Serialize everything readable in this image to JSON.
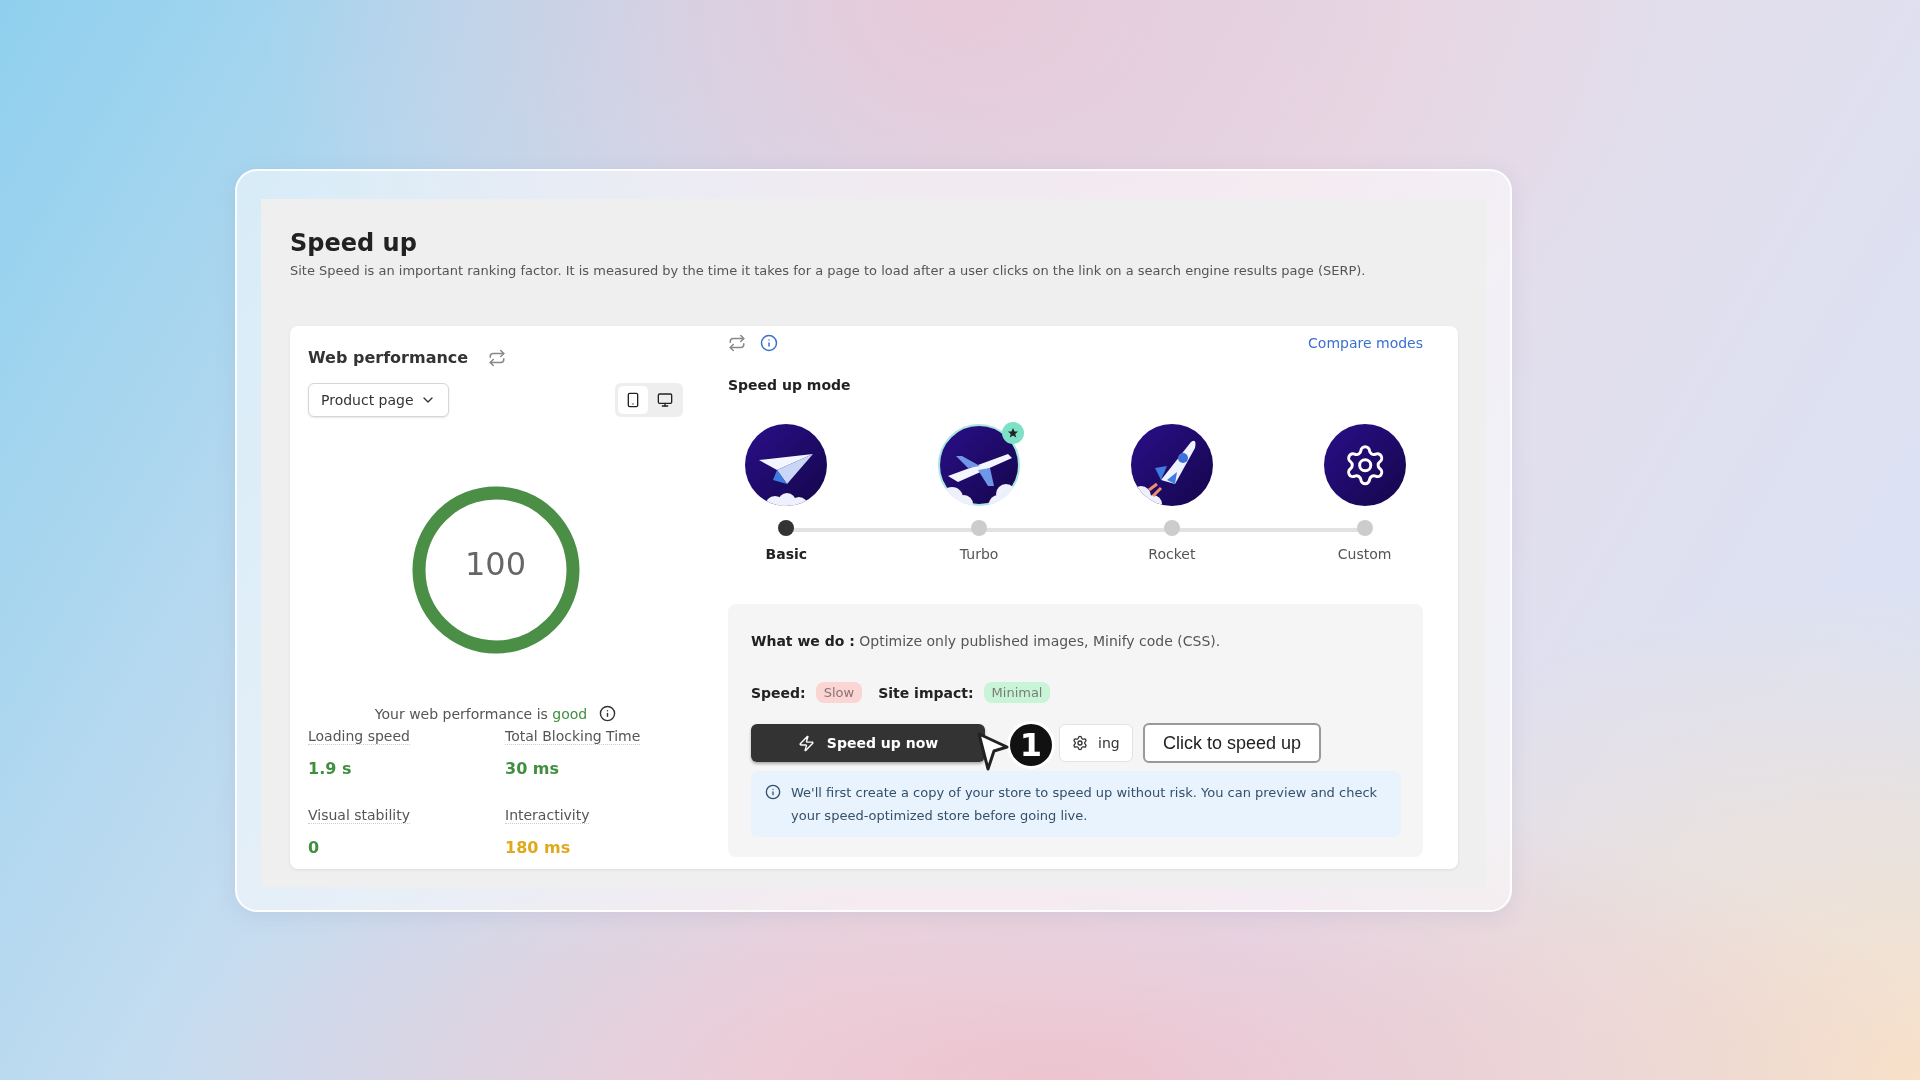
{
  "page": {
    "title": "Speed up",
    "description": "Site Speed is an important ranking factor. It is measured by the time it takes for a page to load after a user clicks on the link on a search engine results page (SERP)."
  },
  "performance": {
    "title": "Web performance",
    "page_select": "Product page",
    "devices": [
      {
        "kind": "mobile",
        "selected": true
      },
      {
        "kind": "desktop",
        "selected": false
      }
    ],
    "score": "100",
    "level": 1,
    "status_text": "Your web performance is",
    "status_word": "good",
    "metrics": [
      {
        "label": "Loading speed",
        "value": "1.9 s",
        "color": "#3f8f3f"
      },
      {
        "label": "Total Blocking Time",
        "value": "30 ms",
        "color": "#3f8f3f"
      },
      {
        "label": "Visual stability",
        "value": "0",
        "color": "#3f8f3f"
      },
      {
        "label": "Interactivity",
        "value": "180 ms",
        "color": "#e0a81a"
      }
    ]
  },
  "modes": {
    "compare_link": "Compare modes",
    "title": "Speed up mode",
    "items": [
      {
        "name": "Basic",
        "kind": "paper-plane",
        "selected": true,
        "featured": false
      },
      {
        "name": "Turbo",
        "kind": "airplane",
        "selected": false,
        "featured": true
      },
      {
        "name": "Rocket",
        "kind": "rocket",
        "selected": false,
        "featured": false
      },
      {
        "name": "Custom",
        "kind": "gear",
        "selected": false,
        "featured": false
      }
    ]
  },
  "details": {
    "what_label": "What we do :",
    "what_text": "Optimize only published images, Minify code (CSS).",
    "ratings": [
      {
        "label": "Speed:",
        "value": "Slow",
        "color": "#fbd4d4"
      },
      {
        "label": "Site impact:",
        "value": "Minimal",
        "color": "#c8f5d8"
      }
    ],
    "primary_button": "Speed up now",
    "settings_button": "ing",
    "notice": "We'll first create a copy of your store to speed up without risk. You can preview and check your speed-optimized store before going live."
  },
  "tutorial": {
    "step": "1",
    "tooltip": "Click to speed up"
  }
}
